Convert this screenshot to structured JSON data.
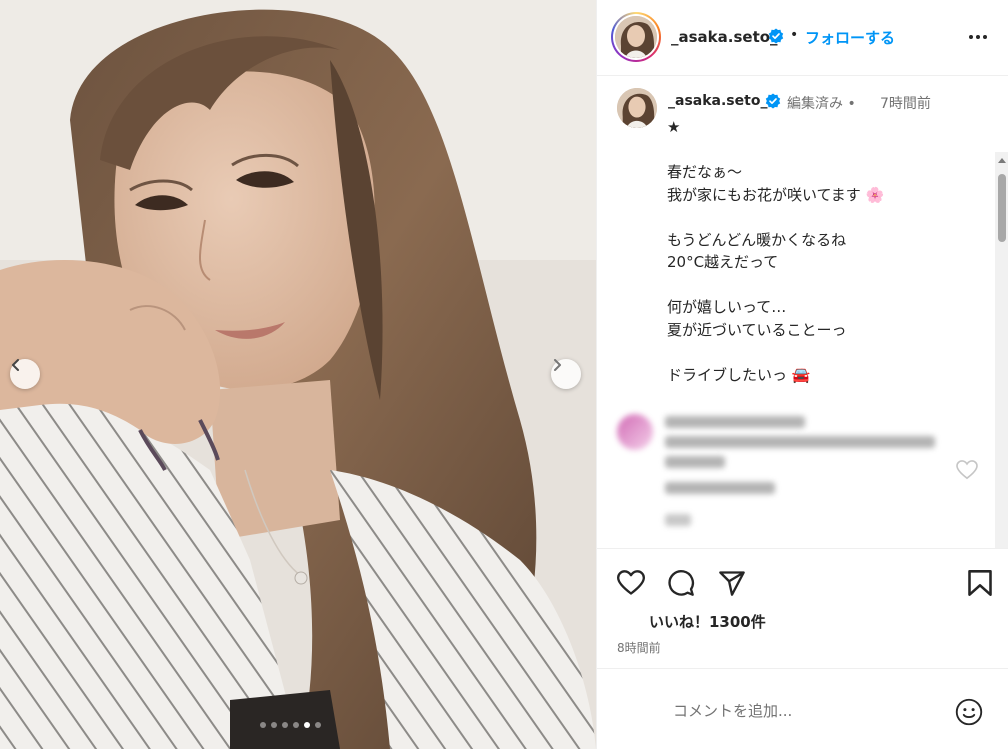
{
  "post": {
    "username": "_asaka.seto_",
    "separator": "•",
    "follow_label": "フォローする",
    "edited_label": "編集済み",
    "time_sep": "•",
    "time_ago": "7時間前",
    "caption": "★\n\n春だなぁ〜\n我が家にもお花が咲いてます 🌸\n\nもうどんどん暖かくなるね\n20°C越えだって\n\n何が嬉しいって…\n夏が近づいていることーっ\n\nドライブしたいっ 🚘",
    "likes": "いいね！1300件",
    "posted_ago": "8時間前",
    "comment_placeholder": "コメントを追加..."
  },
  "carousel": {
    "slide_count": 6,
    "active_index": 4
  },
  "colors": {
    "follow": "#0095f6",
    "verified": "#0095f6",
    "text": "#262626",
    "muted": "#737373"
  },
  "icons": [
    "verified-badge-icon",
    "more-options-icon",
    "chevron-left-icon",
    "chevron-right-icon",
    "heart-icon",
    "comment-icon",
    "share-icon",
    "bookmark-icon",
    "emoji-icon"
  ]
}
